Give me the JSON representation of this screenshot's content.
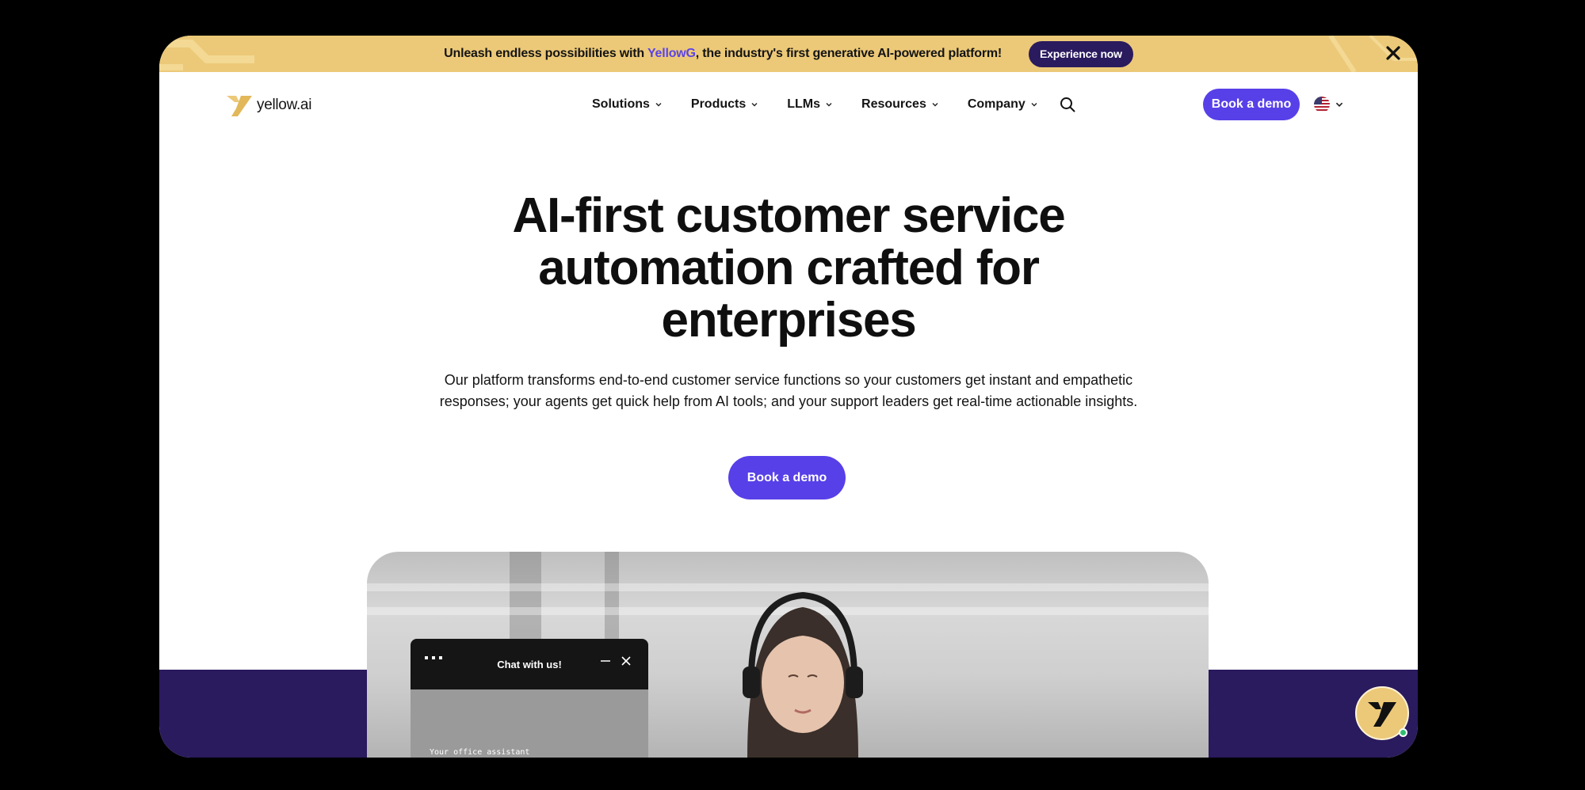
{
  "announcement": {
    "text_before": "Unleash endless possibilities with ",
    "highlight": "YellowG",
    "text_after": ", the industry's first generative AI-powered platform!",
    "cta_label": "Experience now",
    "close_icon": "close-icon"
  },
  "header": {
    "logo_text": "yellow.ai",
    "nav": [
      {
        "label": "Solutions"
      },
      {
        "label": "Products"
      },
      {
        "label": "LLMs"
      },
      {
        "label": "Resources"
      },
      {
        "label": "Company"
      }
    ],
    "search_icon": "search-icon",
    "demo_label": "Book a demo",
    "language_icon": "us-flag-icon"
  },
  "hero": {
    "title_line1": "AI-first customer service",
    "title_line2": "automation crafted for",
    "title_line3": "enterprises",
    "subtitle_line1": "Our platform transforms end-to-end customer service functions so your customers get instant and empathetic",
    "subtitle_line2": "responses; your agents get quick help from AI tools; and your support leaders get real-time actionable insights.",
    "cta_label": "Book a demo"
  },
  "chat_widget": {
    "title": "Chat with us!",
    "body_text": "Your office assistant"
  },
  "colors": {
    "accent": "#5740e8",
    "banner": "#ecc978",
    "dark_purple": "#2a1a5e"
  }
}
